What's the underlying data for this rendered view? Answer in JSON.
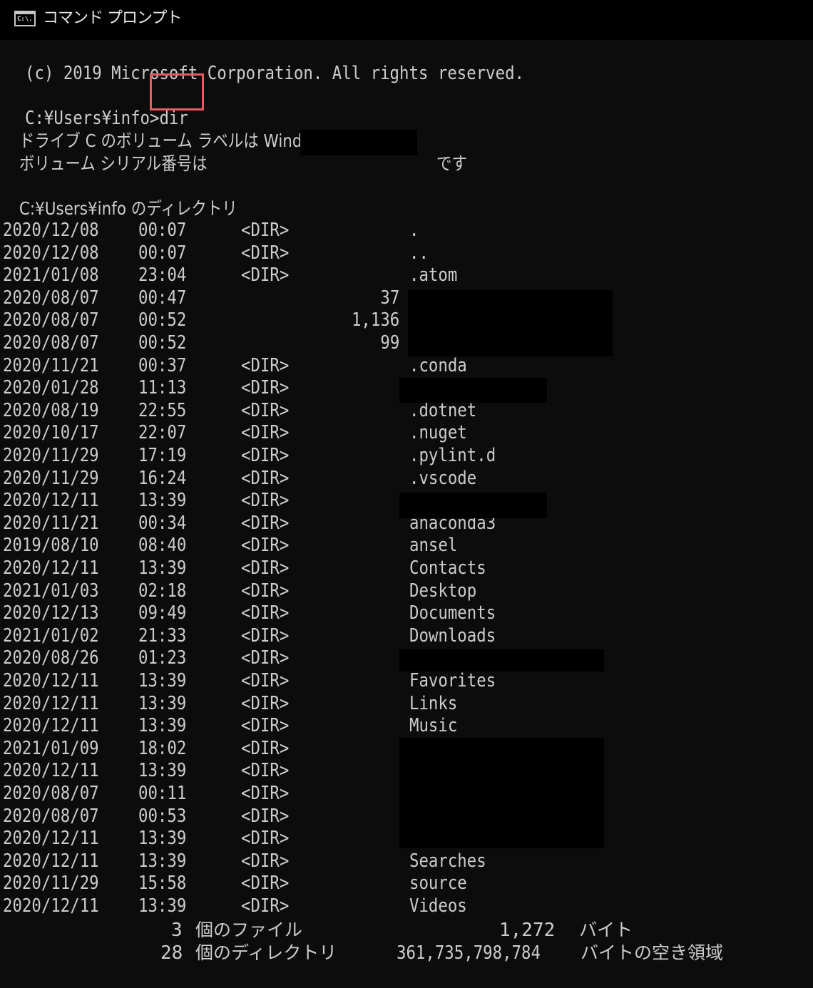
{
  "window": {
    "title": "コマンド プロンプト",
    "icon": "cmd-icon",
    "icon_label": "C:\\."
  },
  "console": {
    "copyright": "(c) 2019 Microsoft Corporation. All rights reserved.",
    "prompt": "C:¥Users¥info>",
    "command": "dir",
    "volume_label_line": " ドライブ C のボリューム ラベルは Windows です",
    "serial_prefix": " ボリューム シリアル番号は",
    "serial_suffix": "です",
    "directory_header": " C:¥Users¥info のディレクトリ",
    "entries": [
      {
        "date": "2020/12/08",
        "time": "00:07",
        "type": "<DIR>",
        "size": "",
        "name": "."
      },
      {
        "date": "2020/12/08",
        "time": "00:07",
        "type": "<DIR>",
        "size": "",
        "name": ".."
      },
      {
        "date": "2021/01/08",
        "time": "23:04",
        "type": "<DIR>",
        "size": "",
        "name": ".atom"
      },
      {
        "date": "2020/08/07",
        "time": "00:47",
        "type": "",
        "size": "37",
        "name": ""
      },
      {
        "date": "2020/08/07",
        "time": "00:52",
        "type": "",
        "size": "1,136",
        "name": ""
      },
      {
        "date": "2020/08/07",
        "time": "00:52",
        "type": "",
        "size": "99",
        "name": ""
      },
      {
        "date": "2020/11/21",
        "time": "00:37",
        "type": "<DIR>",
        "size": "",
        "name": ".conda"
      },
      {
        "date": "2020/01/28",
        "time": "11:13",
        "type": "<DIR>",
        "size": "",
        "name": ""
      },
      {
        "date": "2020/08/19",
        "time": "22:55",
        "type": "<DIR>",
        "size": "",
        "name": ".dotnet"
      },
      {
        "date": "2020/10/17",
        "time": "22:07",
        "type": "<DIR>",
        "size": "",
        "name": ".nuget"
      },
      {
        "date": "2020/11/29",
        "time": "17:19",
        "type": "<DIR>",
        "size": "",
        "name": ".pylint.d"
      },
      {
        "date": "2020/11/29",
        "time": "16:24",
        "type": "<DIR>",
        "size": "",
        "name": ".vscode"
      },
      {
        "date": "2020/12/11",
        "time": "13:39",
        "type": "<DIR>",
        "size": "",
        "name": ""
      },
      {
        "date": "2020/11/21",
        "time": "00:34",
        "type": "<DIR>",
        "size": "",
        "name": "anaconda3"
      },
      {
        "date": "2019/08/10",
        "time": "08:40",
        "type": "<DIR>",
        "size": "",
        "name": "ansel"
      },
      {
        "date": "2020/12/11",
        "time": "13:39",
        "type": "<DIR>",
        "size": "",
        "name": "Contacts"
      },
      {
        "date": "2021/01/03",
        "time": "02:18",
        "type": "<DIR>",
        "size": "",
        "name": "Desktop"
      },
      {
        "date": "2020/12/13",
        "time": "09:49",
        "type": "<DIR>",
        "size": "",
        "name": "Documents"
      },
      {
        "date": "2021/01/02",
        "time": "21:33",
        "type": "<DIR>",
        "size": "",
        "name": "Downloads"
      },
      {
        "date": "2020/08/26",
        "time": "01:23",
        "type": "<DIR>",
        "size": "",
        "name": ""
      },
      {
        "date": "2020/12/11",
        "time": "13:39",
        "type": "<DIR>",
        "size": "",
        "name": "Favorites"
      },
      {
        "date": "2020/12/11",
        "time": "13:39",
        "type": "<DIR>",
        "size": "",
        "name": "Links"
      },
      {
        "date": "2020/12/11",
        "time": "13:39",
        "type": "<DIR>",
        "size": "",
        "name": "Music"
      },
      {
        "date": "2021/01/09",
        "time": "18:02",
        "type": "<DIR>",
        "size": "",
        "name": ""
      },
      {
        "date": "2020/12/11",
        "time": "13:39",
        "type": "<DIR>",
        "size": "",
        "name": ""
      },
      {
        "date": "2020/08/07",
        "time": "00:11",
        "type": "<DIR>",
        "size": "",
        "name": ""
      },
      {
        "date": "2020/08/07",
        "time": "00:53",
        "type": "<DIR>",
        "size": "",
        "name": ""
      },
      {
        "date": "2020/12/11",
        "time": "13:39",
        "type": "<DIR>",
        "size": "",
        "name": ""
      },
      {
        "date": "2020/12/11",
        "time": "13:39",
        "type": "<DIR>",
        "size": "",
        "name": "Searches"
      },
      {
        "date": "2020/11/29",
        "time": "15:58",
        "type": "<DIR>",
        "size": "",
        "name": "source"
      },
      {
        "date": "2020/12/11",
        "time": "13:39",
        "type": "<DIR>",
        "size": "",
        "name": "Videos"
      }
    ],
    "summary": {
      "file_count": "3",
      "file_label": "個のファイル",
      "file_bytes": "1,272",
      "file_bytes_label": "バイト",
      "dir_count": "28",
      "dir_label": "個のディレクトリ",
      "free_bytes": "361,735,798,784",
      "free_bytes_label": "バイトの空き領域"
    }
  },
  "colors": {
    "background": "#0c0c0c",
    "titlebar": "#000000",
    "text": "#cccccc",
    "highlight_border": "#e85c5c",
    "redaction": "#000000"
  }
}
